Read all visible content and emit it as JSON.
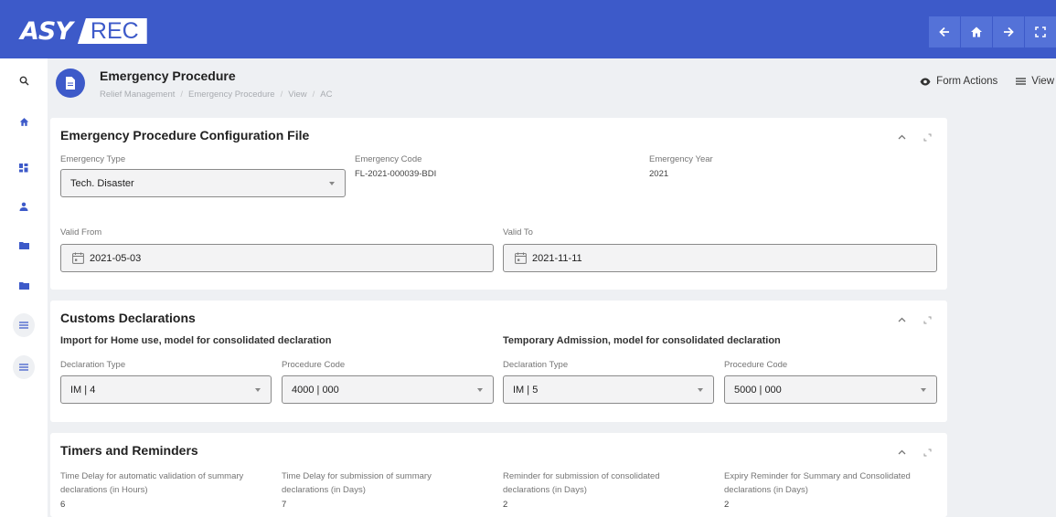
{
  "app": {
    "logo_a": "ASY",
    "logo_b": "REC"
  },
  "header": {
    "title": "Emergency Procedure",
    "breadcrumb": [
      "Relief Management",
      "Emergency Procedure",
      "View",
      "AC"
    ],
    "form_actions": "Form Actions",
    "view": "View"
  },
  "config": {
    "title": "Emergency Procedure Configuration File",
    "type_label": "Emergency Type",
    "type_value": "Tech. Disaster",
    "code_label": "Emergency Code",
    "code_value": "FL-2021-000039-BDI",
    "year_label": "Emergency Year",
    "year_value": "2021",
    "valid_from_label": "Valid From",
    "valid_from_value": "2021-05-03",
    "valid_to_label": "Valid To",
    "valid_to_value": "2021-11-11"
  },
  "customs": {
    "title": "Customs Declarations",
    "import_title": "Import for Home use, model for consolidated declaration",
    "temp_title": "Temporary Admission, model for consolidated declaration",
    "decl_type_label": "Declaration Type",
    "proc_code_label": "Procedure Code",
    "import_decl_type": "IM | 4",
    "import_proc_code": "4000 | 000",
    "temp_decl_type": "IM | 5",
    "temp_proc_code": "5000 | 000"
  },
  "timers": {
    "title": "Timers and Reminders",
    "items": [
      {
        "label_1": "Time Delay for automatic validation of summary",
        "label_2": "declarations (in Hours)",
        "value": "6"
      },
      {
        "label_1": "Time Delay for submission of summary",
        "label_2": "declarations (in Days)",
        "value": "7"
      },
      {
        "label_1": "Reminder for submission of consolidated",
        "label_2": "declarations (in Days)",
        "value": "2"
      },
      {
        "label_1": "Expiry Reminder for Summary and Consolidated",
        "label_2": "declarations (in Days)",
        "value": "2"
      }
    ]
  },
  "colors": {
    "primary": "#3d5ac9",
    "background": "#eef0f3"
  },
  "icons": {
    "topnav": [
      "arrow-left-icon",
      "home-icon",
      "arrow-right-icon",
      "fullscreen-icon"
    ],
    "sidebar": [
      "search-icon",
      "home-icon",
      "dashboard-icon",
      "person-icon",
      "folder-icon",
      "folder-icon",
      "list-icon",
      "list-icon"
    ]
  }
}
